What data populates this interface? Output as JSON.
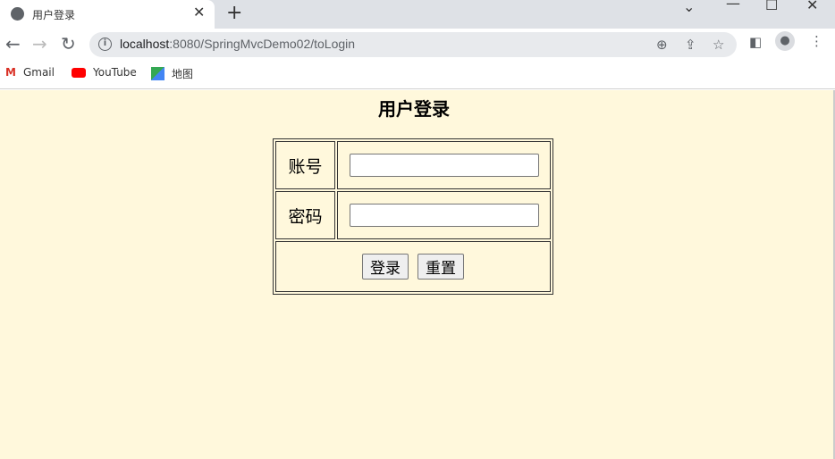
{
  "browser": {
    "tab_title": "用户登录",
    "url_host": "localhost",
    "url_rest": ":8080/SpringMvcDemo02/toLogin",
    "bookmarks": [
      {
        "label": "Gmail",
        "icon": "gmail-icon"
      },
      {
        "label": "YouTube",
        "icon": "youtube-icon"
      },
      {
        "label": "地图",
        "icon": "maps-icon"
      }
    ]
  },
  "page": {
    "title": "用户登录",
    "account_label": "账号",
    "password_label": "密码",
    "account_value": "",
    "password_value": "",
    "login_button": "登录",
    "reset_button": "重置",
    "background_color": "#fff8dc"
  }
}
